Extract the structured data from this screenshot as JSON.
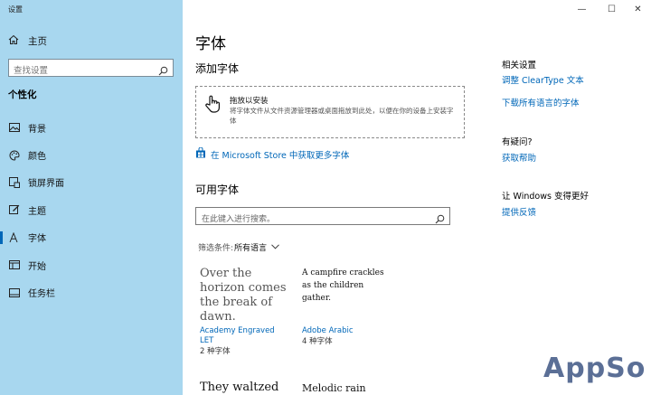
{
  "window": {
    "title": "设置",
    "controls": {
      "minimize": "—",
      "maximize": "☐",
      "close": "✕"
    }
  },
  "sidebar": {
    "home_label": "主页",
    "search_placeholder": "查找设置",
    "section_title": "个性化",
    "items": [
      {
        "label": "背景",
        "icon": "image-icon",
        "active": false
      },
      {
        "label": "颜色",
        "icon": "palette-icon",
        "active": false
      },
      {
        "label": "锁屏界面",
        "icon": "lock-screen-icon",
        "active": false
      },
      {
        "label": "主题",
        "icon": "theme-brush-icon",
        "active": false
      },
      {
        "label": "字体",
        "icon": "font-icon",
        "active": true
      },
      {
        "label": "开始",
        "icon": "start-icon",
        "active": false
      },
      {
        "label": "任务栏",
        "icon": "taskbar-icon",
        "active": false
      }
    ]
  },
  "main": {
    "title": "字体",
    "add_heading": "添加字体",
    "dropzone": {
      "title": "拖放以安装",
      "description": "将字体文件从文件资源管理器或桌面拖放到此处，以便在你的设备上安装字体"
    },
    "store_link": "在 Microsoft Store 中获取更多字体",
    "available_heading": "可用字体",
    "font_search_placeholder": "在此键入进行搜索。",
    "filter_label": "筛选条件:",
    "filter_value": "所有语言",
    "fonts": [
      {
        "preview": "Over the horizon comes the break of dawn.",
        "name": "Academy Engraved LET",
        "count": "2 种字体"
      },
      {
        "preview": "A campfire crackles as the children gather.",
        "name": "Adobe Arabic",
        "count": "4 种字体"
      },
      {
        "preview": "They waltzed"
      },
      {
        "preview": "Melodic rain"
      }
    ]
  },
  "right": {
    "related_heading": "相关设置",
    "cleartype_link": "调整 ClearType 文本",
    "download_link": "下载所有语言的字体",
    "question_heading": "有疑问?",
    "help_link": "获取帮助",
    "improve_heading": "让 Windows 变得更好",
    "feedback_link": "提供反馈"
  },
  "watermark": "AppSo",
  "colors": {
    "sidebar_bg": "#a8d7ef",
    "accent": "#0067b8",
    "watermark": "#5b6f96"
  }
}
